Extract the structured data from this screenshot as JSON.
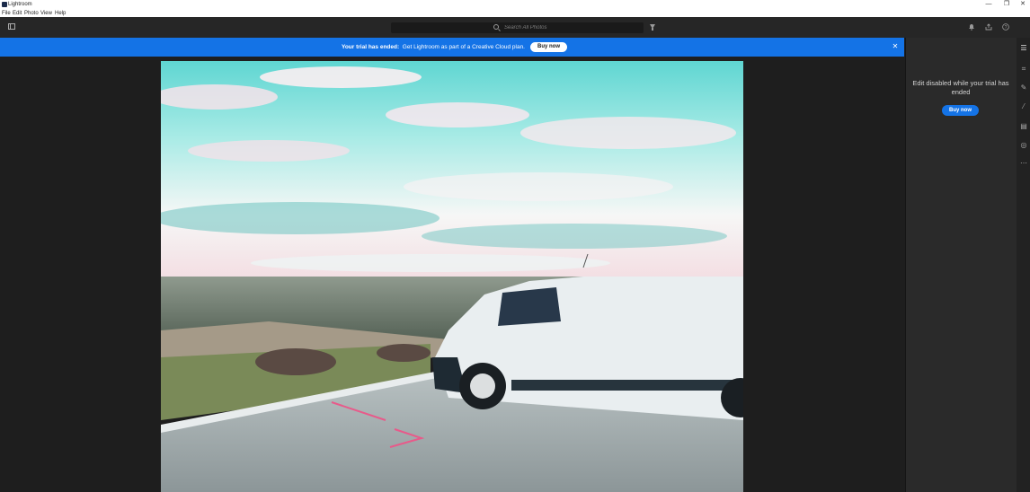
{
  "window": {
    "title": "Lightroom",
    "controls": [
      "—",
      "❐",
      "✕"
    ]
  },
  "menu": [
    "File",
    "Edit",
    "Photo",
    "View",
    "Help"
  ],
  "toolbar": {
    "search_placeholder": "Search All Photos",
    "icons": [
      "sidebar-toggle-icon",
      "search-icon",
      "filter-icon",
      "bell-icon",
      "share-icon",
      "help-icon"
    ]
  },
  "banner": {
    "bold_text": "Your trial has ended:",
    "text": "Get Lightroom as part of a Creative Cloud plan.",
    "buy_label": "Buy now",
    "close_glyph": "✕",
    "color": "#1473e6"
  },
  "photo": {
    "description_icon": "photo-preview"
  },
  "right_panel": {
    "message": "Edit disabled while your trial has ended",
    "buy_label": "Buy now"
  },
  "tools": [
    "edit-sliders-icon",
    "crop-icon",
    "healing-icon",
    "brush-icon",
    "gradient-icon",
    "radial-icon",
    "more-icon"
  ],
  "tool_glyphs": [
    "☰",
    "⌗",
    "✎",
    "⁄",
    "▤",
    "◎",
    "⋯"
  ]
}
